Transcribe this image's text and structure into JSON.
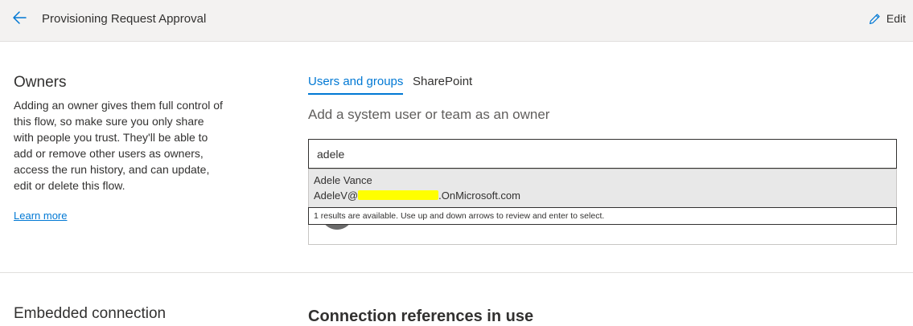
{
  "header": {
    "title": "Provisioning Request Approval",
    "edit_label": "Edit",
    "icons": {
      "back": "arrow-left-icon",
      "edit": "pencil-icon"
    }
  },
  "owners": {
    "title": "Owners",
    "description": "Adding an owner gives them full control of this flow, so make sure you only share with people you trust. They'll be able to add or remove other users as owners, access the run history, and can update, edit or delete this flow.",
    "learn_more": "Learn more",
    "tabs": [
      {
        "label": "Users and groups",
        "active": true
      },
      {
        "label": "SharePoint",
        "active": false
      }
    ],
    "hint": "Add a system user or team as an owner",
    "search_value": "adele",
    "suggestion": {
      "name": "Adele Vance",
      "email_prefix": "AdeleV@",
      "email_suffix": ".OnMicrosoft.com"
    },
    "status_text": "1 results are available. Use up and down arrows to review and enter to select."
  },
  "embedded": {
    "title": "Embedded connection"
  },
  "connections": {
    "title": "Connection references in use"
  },
  "colors": {
    "accent": "#0078d4",
    "header_bg": "#f3f2f1",
    "suggestion_bg": "#e8e8e8",
    "redaction": "#ffff00"
  }
}
